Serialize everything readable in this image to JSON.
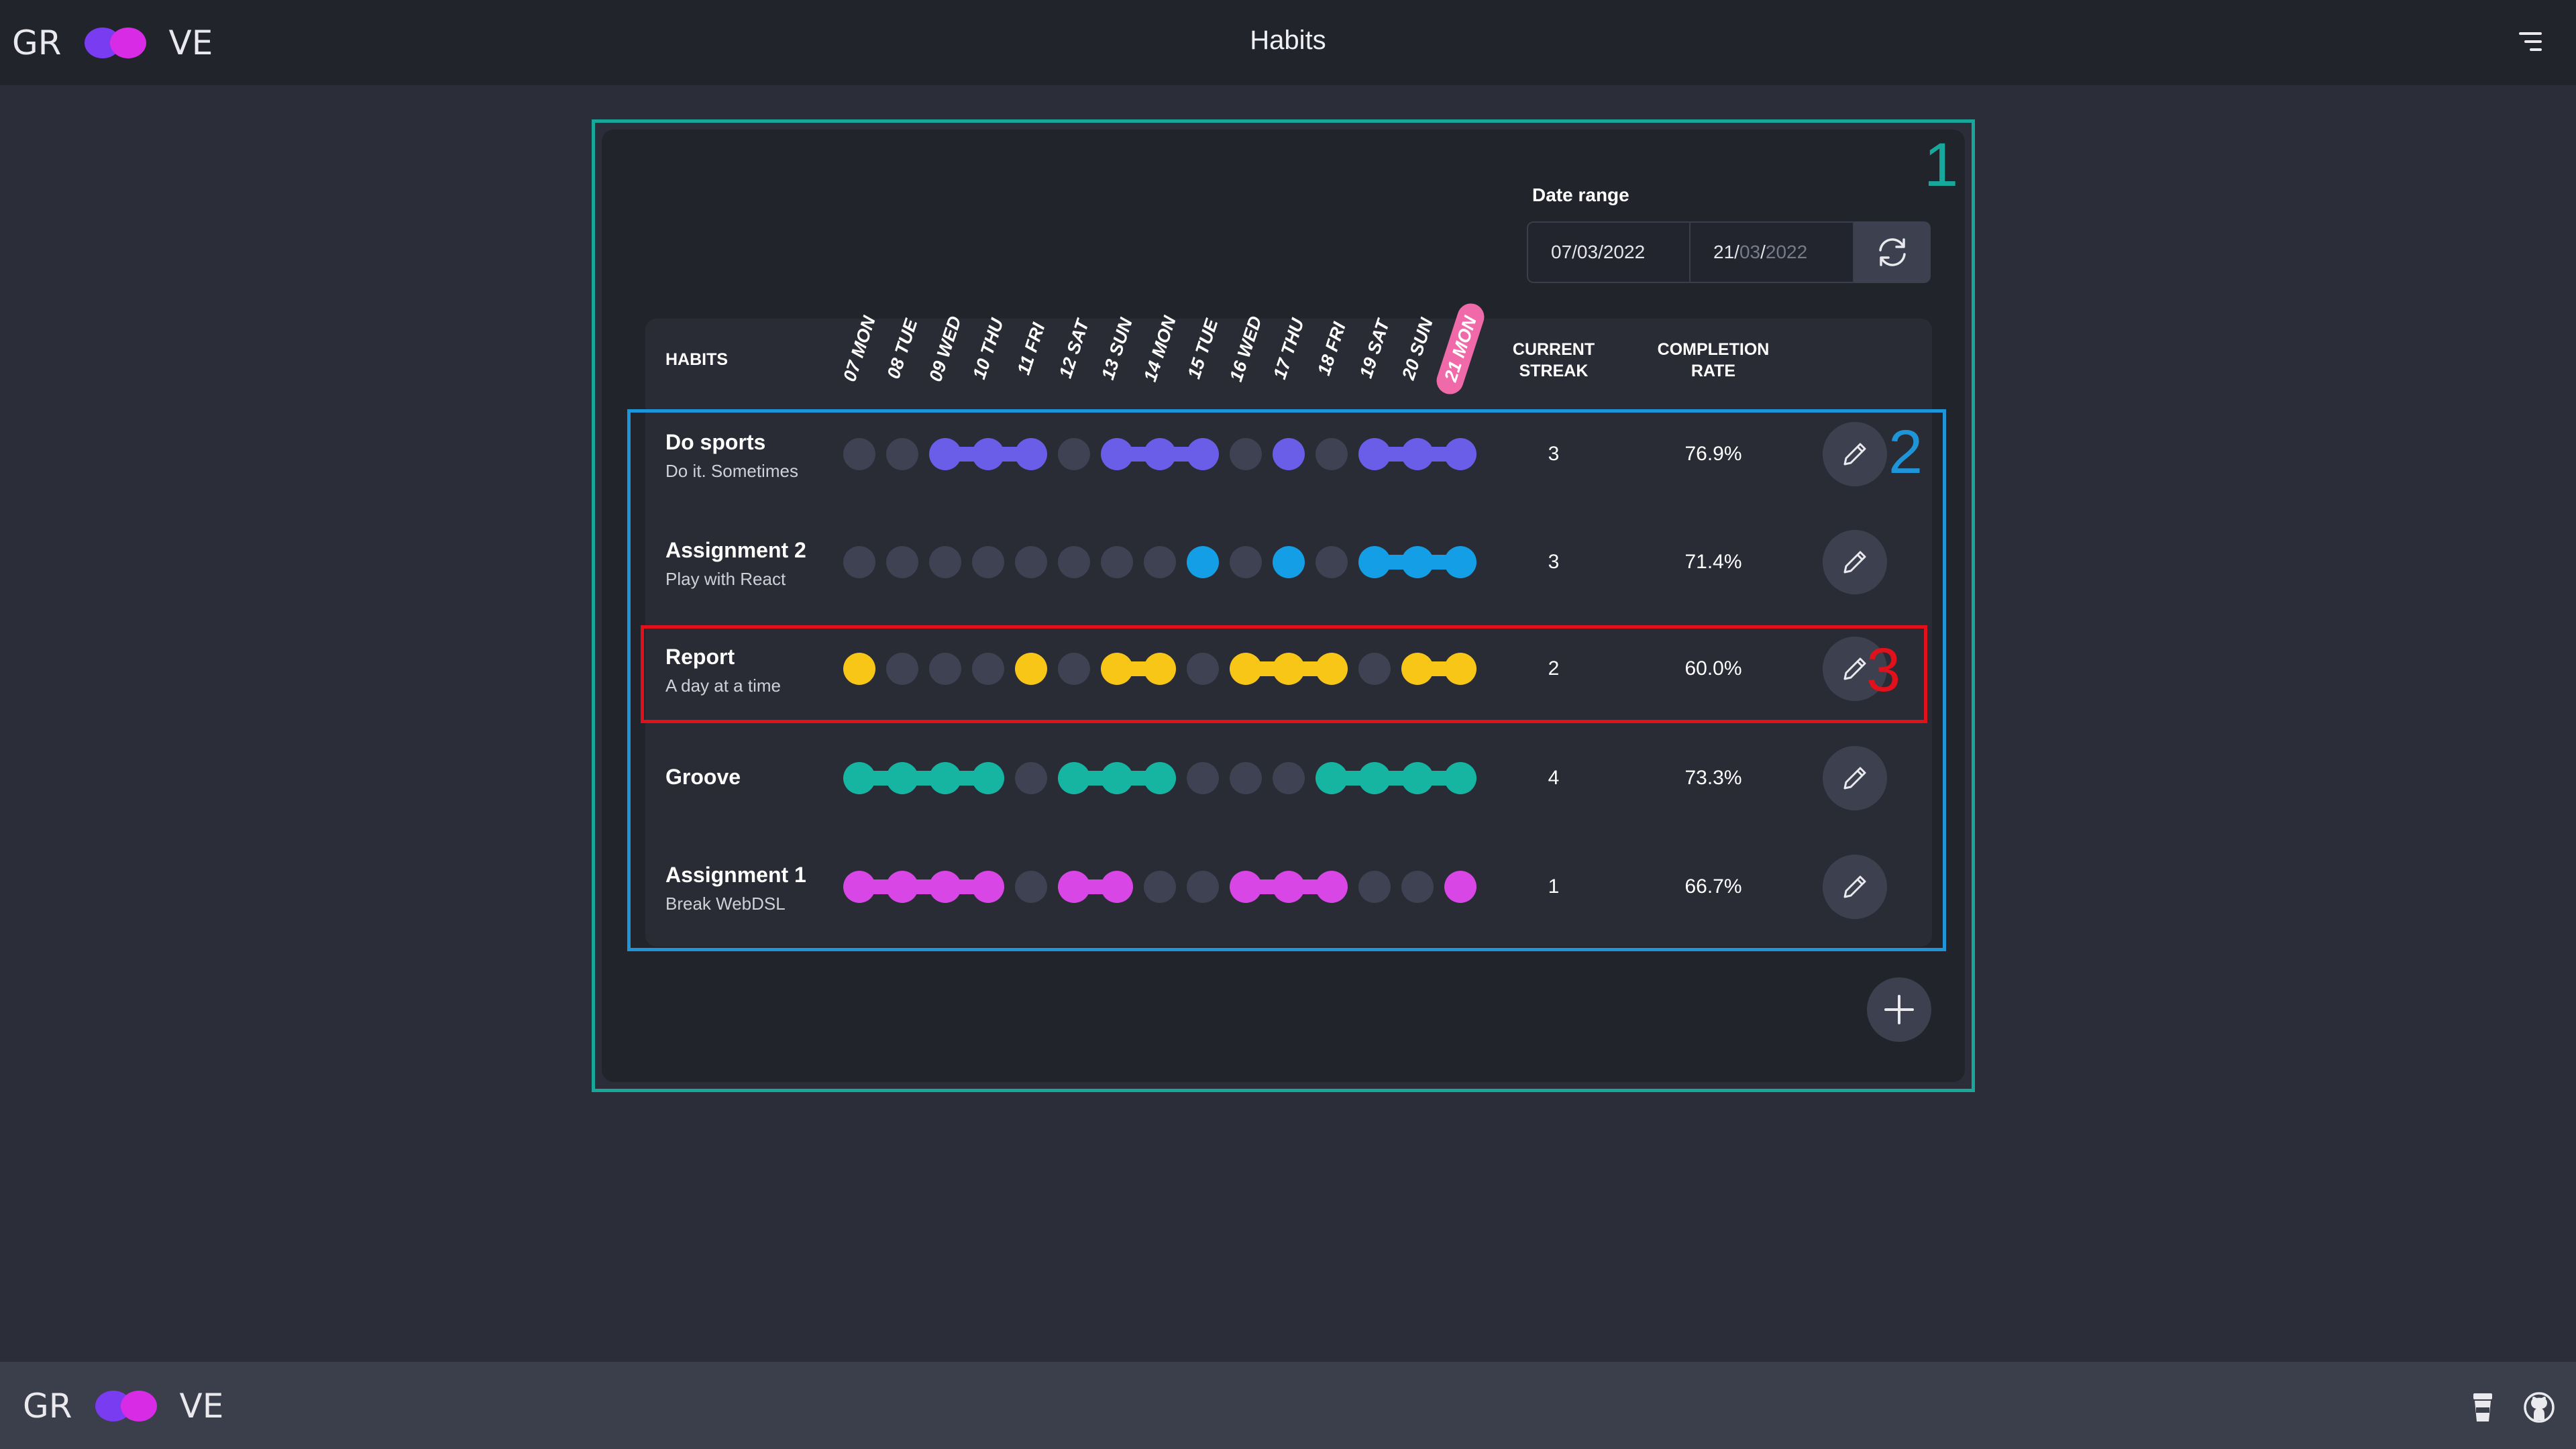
{
  "header": {
    "logo": {
      "left": "GR",
      "right": "VE"
    },
    "title": "Habits"
  },
  "footer": {
    "logo": {
      "left": "GR",
      "right": "VE"
    }
  },
  "annotations": [
    "1",
    "2",
    "3"
  ],
  "date_range": {
    "label": "Date range",
    "start": "07/03/2022",
    "end": {
      "day": "21/",
      "month": "03",
      "sep": "/",
      "year": "2022"
    }
  },
  "table": {
    "headers": {
      "habits": "HABITS",
      "streak_1": "CURRENT",
      "streak_2": "STREAK",
      "rate_1": "COMPLETION",
      "rate_2": "RATE"
    },
    "days": [
      "07 MON",
      "08 TUE",
      "09 WED",
      "10 THU",
      "11 FRI",
      "12 SAT",
      "13 SUN",
      "14 MON",
      "15 TUE",
      "16 WED",
      "17 THU",
      "18 FRI",
      "19 SAT",
      "20 SUN",
      "21 MON"
    ],
    "habits": [
      {
        "name": "Do sports",
        "description": "Do it. Sometimes",
        "color": "#6a5ee8",
        "days": [
          0,
          0,
          1,
          1,
          1,
          0,
          1,
          1,
          1,
          0,
          1,
          0,
          1,
          1,
          1
        ],
        "current_streak": "3",
        "completion_rate": "76.9%"
      },
      {
        "name": "Assignment 2",
        "description": "Play with React",
        "color": "#149ee6",
        "days": [
          0,
          0,
          0,
          0,
          0,
          0,
          0,
          0,
          1,
          0,
          1,
          0,
          1,
          1,
          1
        ],
        "current_streak": "3",
        "completion_rate": "71.4%"
      },
      {
        "name": "Report",
        "description": "A day at a time",
        "color": "#f7c616",
        "days": [
          1,
          0,
          0,
          0,
          1,
          0,
          1,
          1,
          0,
          1,
          1,
          1,
          0,
          1,
          1
        ],
        "current_streak": "2",
        "completion_rate": "60.0%"
      },
      {
        "name": "Groove",
        "description": "",
        "color": "#16b5a2",
        "days": [
          1,
          1,
          1,
          1,
          0,
          1,
          1,
          1,
          0,
          0,
          0,
          1,
          1,
          1,
          1
        ],
        "current_streak": "4",
        "completion_rate": "73.3%"
      },
      {
        "name": "Assignment 1",
        "description": "Break WebDSL",
        "color": "#d847e6",
        "days": [
          1,
          1,
          1,
          1,
          0,
          1,
          1,
          0,
          0,
          1,
          1,
          1,
          0,
          0,
          1
        ],
        "current_streak": "1",
        "completion_rate": "66.7%"
      }
    ]
  },
  "colors": {
    "inactive_dot": "#3f4252",
    "today_badge": "#f06aaa",
    "outer_box": "#17a79b",
    "list_box": "#1f95d9",
    "row_box": "#e0111a"
  },
  "icons": {
    "menu": "menu-icon",
    "refresh": "refresh-icon",
    "edit": "pencil-icon",
    "add": "plus-icon",
    "cup": "cup-icon",
    "github": "github-icon"
  }
}
